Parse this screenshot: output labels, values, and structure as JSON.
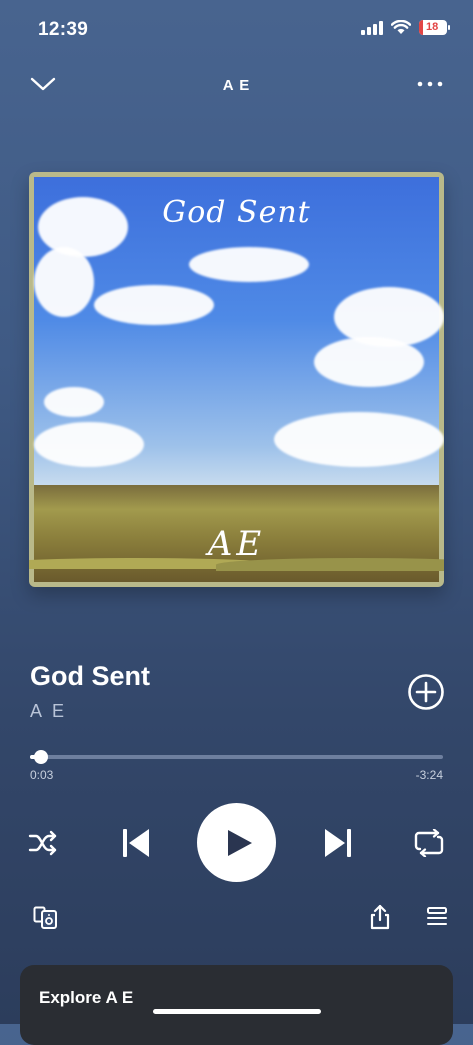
{
  "status_bar": {
    "time": "12:39",
    "battery": "18"
  },
  "header": {
    "title": "A E"
  },
  "album_art": {
    "top_text": "God Sent",
    "bottom_text": "AE"
  },
  "track": {
    "title": "God Sent",
    "artist": "A E"
  },
  "playback": {
    "elapsed": "0:03",
    "remaining": "-3:24",
    "progress_fraction": 0.02
  },
  "explore": {
    "label": "Explore A E"
  },
  "colors": {
    "background": "#3f5a84",
    "accent": "#ffffff",
    "battery_low": "#e24545"
  },
  "icons": [
    "chevron-down-icon",
    "more-icon",
    "add-icon",
    "shuffle-icon",
    "previous-icon",
    "play-icon",
    "next-icon",
    "repeat-icon",
    "connect-device-icon",
    "share-icon",
    "queue-icon"
  ]
}
